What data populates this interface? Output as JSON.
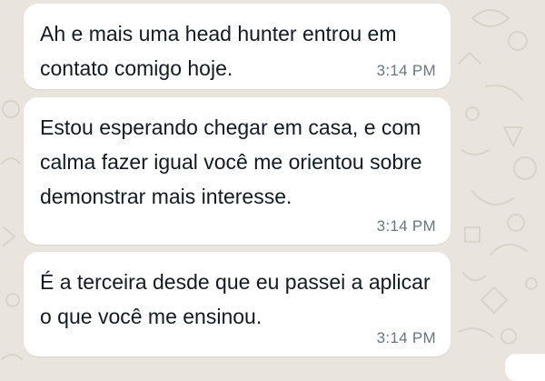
{
  "chat": {
    "messages": [
      {
        "text": "Ah e mais uma head hunter entrou em contato comigo hoje.",
        "time": "3:14 PM"
      },
      {
        "text": "Estou esperando chegar em casa, e com calma fazer igual você me orientou sobre demonstrar mais interesse.",
        "time": "3:14 PM"
      },
      {
        "text": "É a terceira desde que eu passei a aplicar o que você me ensinou.",
        "time": "3:14 PM"
      }
    ]
  },
  "colors": {
    "background": "#e9e5de",
    "bubble": "#ffffff",
    "text": "#111b21",
    "timestamp": "#667781"
  }
}
